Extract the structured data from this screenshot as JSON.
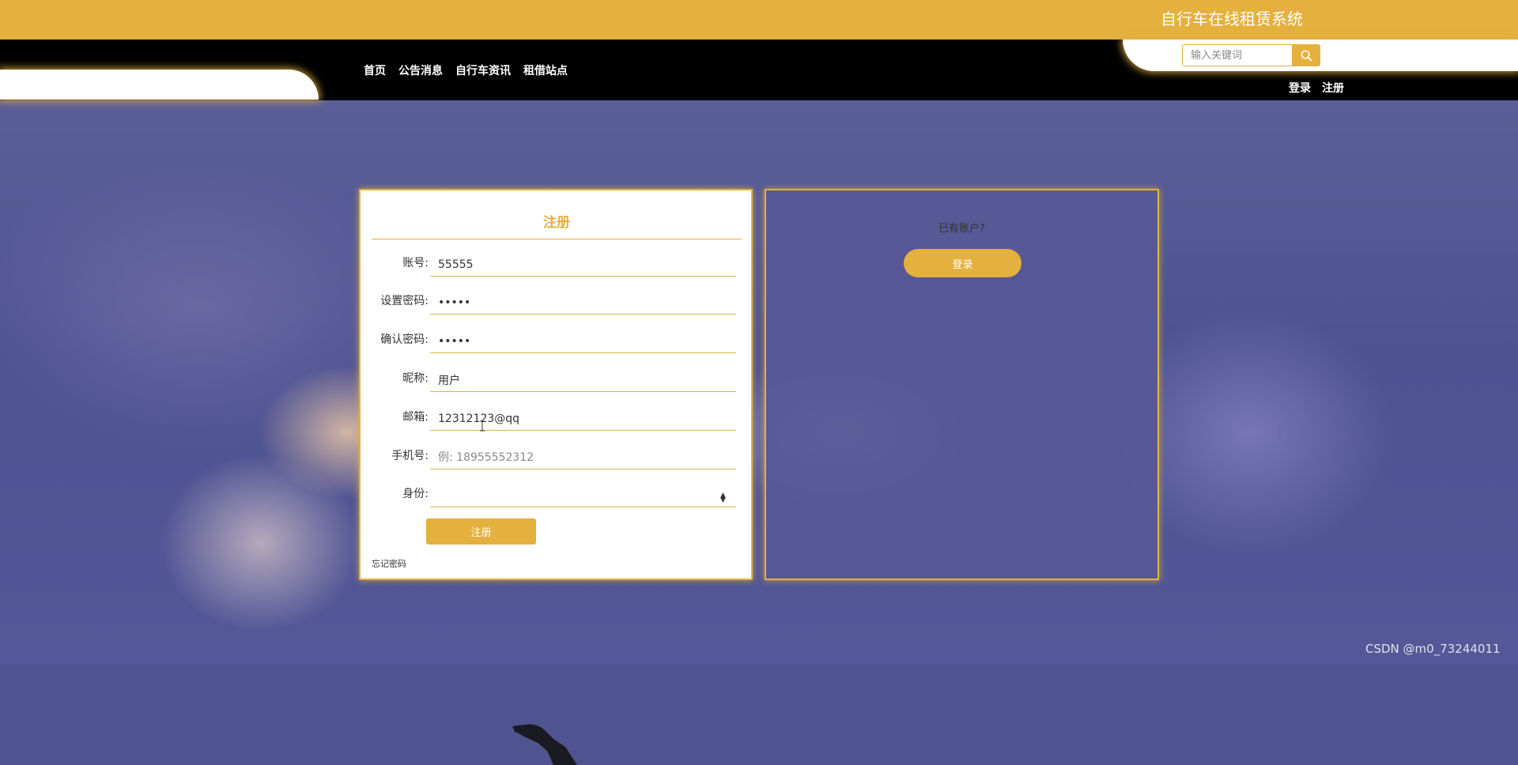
{
  "header": {
    "site_title": "自行车在线租赁系统",
    "nav_items": [
      "首页",
      "公告消息",
      "自行车资讯",
      "租借站点"
    ],
    "search_placeholder": "输入关键词",
    "search_icon": "search-icon",
    "auth_links": [
      "登录",
      "注册"
    ]
  },
  "register_form": {
    "title": "注册",
    "fields": [
      {
        "label": "账号:",
        "value": "55555",
        "placeholder": ""
      },
      {
        "label": "设置密码:",
        "value": "•••••",
        "placeholder": ""
      },
      {
        "label": "确认密码:",
        "value": "•••••",
        "placeholder": ""
      },
      {
        "label": "昵称:",
        "value": "用户",
        "placeholder": ""
      },
      {
        "label": "邮箱:",
        "value": "12312123@qq",
        "placeholder": ""
      },
      {
        "label": "手机号:",
        "value": "",
        "placeholder": "例: 18955552312"
      },
      {
        "label": "身份:",
        "value": "",
        "placeholder": ""
      }
    ],
    "submit_label": "注册",
    "forgot_label": "忘记密码"
  },
  "login_panel": {
    "hint": "已有账户?",
    "button_label": "登录"
  },
  "watermark": "CSDN @m0_73244011",
  "colors": {
    "accent": "#e4b03e",
    "nav_bg": "#000000",
    "panel_bg": "#ffffff",
    "login_panel_bg": "#585896"
  }
}
